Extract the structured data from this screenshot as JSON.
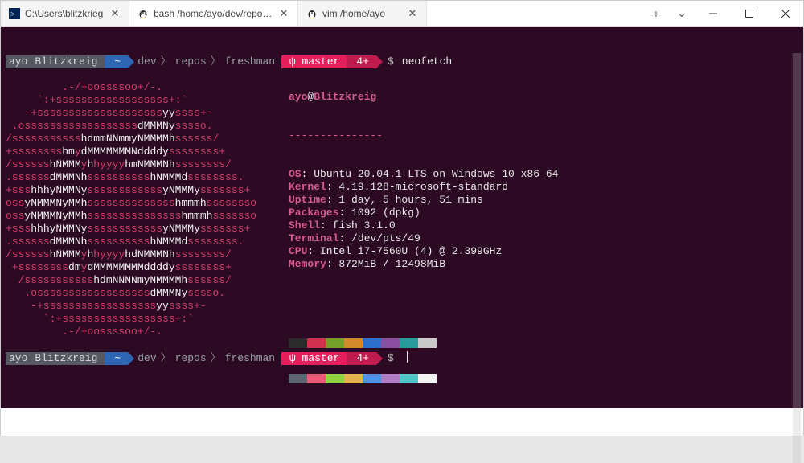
{
  "tabs": [
    {
      "icon": "powershell-icon",
      "title": "C:\\Users\\blitzkrieg",
      "active": false
    },
    {
      "icon": "tux-icon",
      "title": "bash /home/ayo/dev/repos/fres",
      "active": true
    },
    {
      "icon": "tux-icon",
      "title": "vim /home/ayo",
      "active": false
    }
  ],
  "prompt": {
    "user": "ayo",
    "host": "Blitzkreig",
    "home": "~",
    "path_parts": [
      "dev",
      "repos",
      "freshman"
    ],
    "git_glyph": "ψ",
    "branch": "master",
    "count": "4+",
    "sigil": "$",
    "command": "neofetch"
  },
  "logo_lines": [
    [
      [
        "r",
        "         .-/+oossssoo+/-."
      ]
    ],
    [
      [
        "r",
        "     `:+ssssssssssssssssss+:`"
      ]
    ],
    [
      [
        "r",
        "   -+ssssssssssssssssssss"
      ],
      [
        "w",
        "yy"
      ],
      [
        "r",
        "ssss+-"
      ]
    ],
    [
      [
        "r",
        " .ossssssssssssssssss"
      ],
      [
        "w",
        "dMMMNy"
      ],
      [
        "r",
        "sssso."
      ]
    ],
    [
      [
        "r",
        "/sssssssssss"
      ],
      [
        "w",
        "hdmmNNmmyNMMMMh"
      ],
      [
        "r",
        "ssssss/"
      ]
    ],
    [
      [
        "r",
        "+ssssssss"
      ],
      [
        "w",
        "hm"
      ],
      [
        "r",
        "y"
      ],
      [
        "w",
        "dMMMMMMMNddddy"
      ],
      [
        "r",
        "ssssssss+"
      ]
    ],
    [
      [
        "r",
        "/ssssss"
      ],
      [
        "w",
        "hNMMM"
      ],
      [
        "r",
        "y"
      ],
      [
        "w",
        "h"
      ],
      [
        "r",
        "hyyyy"
      ],
      [
        "w",
        "hmNMMMNh"
      ],
      [
        "r",
        "ssssssss/"
      ]
    ],
    [
      [
        "r",
        ".ssssss"
      ],
      [
        "w",
        "dMMMNh"
      ],
      [
        "r",
        "ssssssssss"
      ],
      [
        "w",
        "hNMMMd"
      ],
      [
        "r",
        "ssssssss."
      ]
    ],
    [
      [
        "r",
        "+sss"
      ],
      [
        "w",
        "hhhyNMMNy"
      ],
      [
        "r",
        "ssssssssssss"
      ],
      [
        "w",
        "yNMMMy"
      ],
      [
        "r",
        "sssssss+"
      ]
    ],
    [
      [
        "r",
        "oss"
      ],
      [
        "w",
        "yNMMMNyMMh"
      ],
      [
        "r",
        "ssssssssssssss"
      ],
      [
        "w",
        "hmmmh"
      ],
      [
        "r",
        "ssssssso"
      ]
    ],
    [
      [
        "r",
        "oss"
      ],
      [
        "w",
        "yNMMMNyMMh"
      ],
      [
        "r",
        "sssssssssssssss"
      ],
      [
        "w",
        "hmmmh"
      ],
      [
        "r",
        "sssssso"
      ]
    ],
    [
      [
        "r",
        "+sss"
      ],
      [
        "w",
        "hhhyNMMNy"
      ],
      [
        "r",
        "ssssssssssss"
      ],
      [
        "w",
        "yNMMMy"
      ],
      [
        "r",
        "sssssss+"
      ]
    ],
    [
      [
        "r",
        ".ssssss"
      ],
      [
        "w",
        "dMMMNh"
      ],
      [
        "r",
        "ssssssssss"
      ],
      [
        "w",
        "hNMMMd"
      ],
      [
        "r",
        "ssssssss."
      ]
    ],
    [
      [
        "r",
        "/ssssss"
      ],
      [
        "w",
        "hNMMM"
      ],
      [
        "r",
        "y"
      ],
      [
        "w",
        "h"
      ],
      [
        "r",
        "hyyyy"
      ],
      [
        "w",
        "hdNMMMNh"
      ],
      [
        "r",
        "ssssssss/"
      ]
    ],
    [
      [
        "r",
        " +ssssssss"
      ],
      [
        "w",
        "dm"
      ],
      [
        "r",
        "y"
      ],
      [
        "w",
        "dMMMMMMMMddddy"
      ],
      [
        "r",
        "ssssssss+"
      ]
    ],
    [
      [
        "r",
        "  /sssssssssss"
      ],
      [
        "w",
        "hdmNNNNmyNMMMMh"
      ],
      [
        "r",
        "ssssss/"
      ]
    ],
    [
      [
        "r",
        "   .ossssssssssssssssss"
      ],
      [
        "w",
        "dMMMNy"
      ],
      [
        "r",
        "sssso."
      ]
    ],
    [
      [
        "r",
        "    -+ssssssssssssssssss"
      ],
      [
        "w",
        "yy"
      ],
      [
        "r",
        "ssss+-"
      ]
    ],
    [
      [
        "r",
        "      `:+ssssssssssssssssss+:`"
      ]
    ],
    [
      [
        "r",
        "         .-/+oossssoo+/-."
      ]
    ]
  ],
  "neofetch": {
    "head_user": "ayo",
    "head_at": "@",
    "head_host": "Blitzkreig",
    "sep": "---------------",
    "items": [
      [
        "OS",
        "Ubuntu 20.04.1 LTS on Windows 10 x86_64"
      ],
      [
        "Kernel",
        "4.19.128-microsoft-standard"
      ],
      [
        "Uptime",
        "1 day, 5 hours, 51 mins"
      ],
      [
        "Packages",
        "1092 (dpkg)"
      ],
      [
        "Shell",
        "fish 3.1.0"
      ],
      [
        "Terminal",
        "/dev/pts/49"
      ],
      [
        "CPU",
        "Intel i7-7560U (4) @ 2.399GHz"
      ],
      [
        "Memory",
        "872MiB / 12498MiB"
      ]
    ],
    "palette_row1": [
      "#2b2b2b",
      "#d12f4e",
      "#74a02a",
      "#d28a2b",
      "#2b6fcb",
      "#8a4fa0",
      "#2a9b9b",
      "#c9c9c9"
    ],
    "palette_row2": [
      "#5b6670",
      "#e85a75",
      "#8ed43f",
      "#e6b24c",
      "#4f93e6",
      "#b07cc6",
      "#4fc5c5",
      "#f2f2f2"
    ]
  }
}
